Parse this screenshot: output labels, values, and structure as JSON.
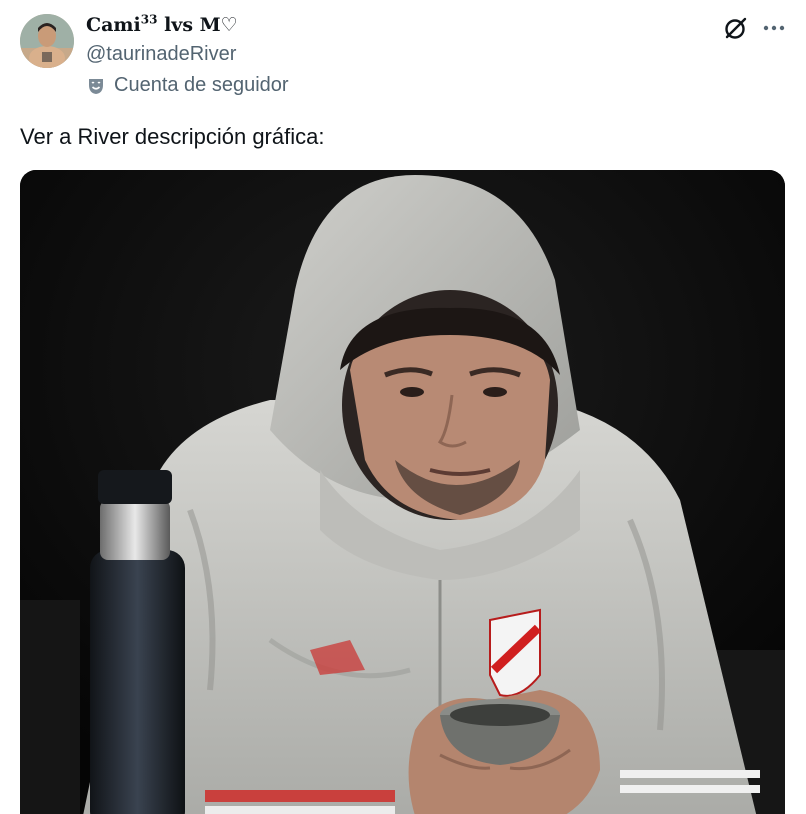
{
  "author": {
    "display_name": "Cami",
    "display_name_superscript": "33",
    "display_name_suffix": " lvs M♡",
    "handle": "@taurinadeRiver",
    "avatar_icon": "profile-photo"
  },
  "follower_badge": {
    "icon": "smiling-mask-icon",
    "text": "Cuenta de seguidor"
  },
  "header_actions": {
    "grok_icon": "grok-slash-circle-icon",
    "more_icon": "ellipsis-icon"
  },
  "tweet": {
    "text": "Ver a River descripción gráfica:"
  },
  "media": {
    "type": "photo",
    "icon": "photo"
  },
  "colors": {
    "text_primary": "#0f1419",
    "text_secondary": "#536471",
    "background": "#ffffff",
    "photo_background": "#0b0b0b"
  }
}
